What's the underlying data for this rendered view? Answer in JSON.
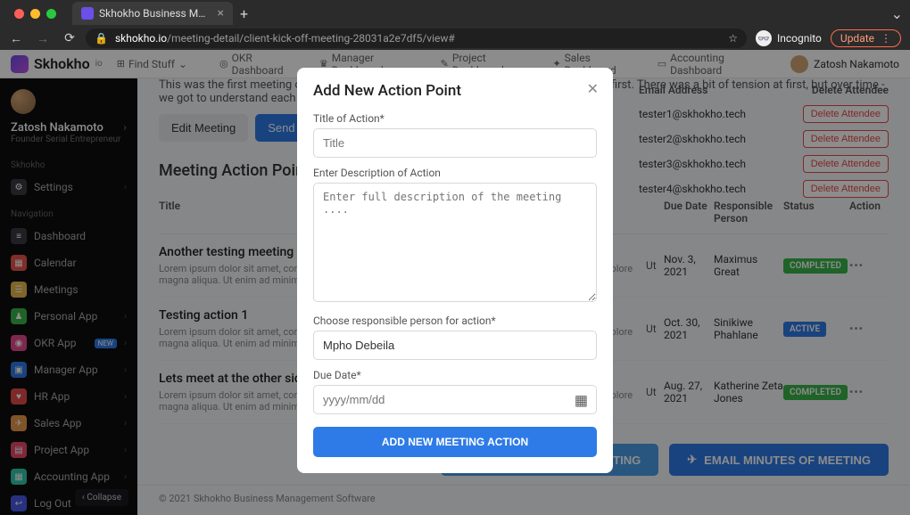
{
  "browser": {
    "tab_title": "Skhokho Business Managemen",
    "url_host": "skhokho.io",
    "url_path": "/meeting-detail/client-kick-off-meeting-28031a2e7df5/view#",
    "incognito_label": "Incognito",
    "update_label": "Update"
  },
  "app": {
    "brand": "Skhokho",
    "brand_sub": "io",
    "find_label": "Find Stuff",
    "topnav": [
      {
        "icon": "◎",
        "label": "OKR Dashboard"
      },
      {
        "icon": "♛",
        "label": "Manager Dashboard"
      },
      {
        "icon": "✎",
        "label": "Project Dashboard"
      },
      {
        "icon": "✦",
        "label": "Sales Dashboard"
      },
      {
        "icon": "▭",
        "label": "Accounting Dashboard"
      }
    ],
    "user_name": "Zatosh Nakamoto"
  },
  "sidebar": {
    "user_name": "Zatosh Nakamoto",
    "user_role": "Founder Serial Entrepreneur",
    "section1": "Skhokho",
    "settings_label": "Settings",
    "section2": "Navigation",
    "items": [
      {
        "label": "Dashboard",
        "color": "#3a3a42",
        "icon": "≡"
      },
      {
        "label": "Calendar",
        "color": "#e8554a",
        "icon": "▦"
      },
      {
        "label": "Meetings",
        "color": "#e8b84a",
        "icon": "☰"
      },
      {
        "label": "Personal App",
        "color": "#3ab54a",
        "icon": "♟"
      },
      {
        "label": "OKR App",
        "color": "#e84a8e",
        "icon": "◉",
        "badge": "NEW"
      },
      {
        "label": "Manager App",
        "color": "#2e7be8",
        "icon": "▣"
      },
      {
        "label": "HR App",
        "color": "#e84a4a",
        "icon": "♥"
      },
      {
        "label": "Sales App",
        "color": "#e89a4a",
        "icon": "✈"
      },
      {
        "label": "Project App",
        "color": "#e84a6a",
        "icon": "▤"
      },
      {
        "label": "Accounting App",
        "color": "#2ec8a8",
        "icon": "▦"
      },
      {
        "label": "Log Out",
        "color": "#4a5ae8",
        "icon": "↩"
      }
    ],
    "collapse_label": "Collapse"
  },
  "page": {
    "desc": "This was the first meeting of many, we discussed the things that the client wanted done first. There was a bit of tension at first, but over time - we got to understand each other.",
    "edit_btn": "Edit Meeting",
    "send_btn": "Send Meeting Invite",
    "section_title": "Meeting Action Points",
    "headers": {
      "title": "Title",
      "due": "Due Date",
      "resp": "Responsible Person",
      "status": "Status",
      "action": "Action"
    },
    "rows": [
      {
        "title": "Another testing meeting action point",
        "desc": "Lorem ipsum dolor sit amet, consectetur adipiscing elit, sed do eiusmod tempor incididunt ut labore et dolore magna aliqua. Ut enim ad minim veniam, quis nostrud exercitation",
        "ut": "Ut",
        "due": "Nov. 3, 2021",
        "resp": "Maximus Great",
        "status": "COMPLETED",
        "status_class": "status-completed"
      },
      {
        "title": "Testing action 1",
        "desc": "Lorem ipsum dolor sit amet, consectetur adipiscing elit, sed do eiusmod tempor incididunt ut labore et dolore magna aliqua. Ut enim ad minim veniam, quis nostrud exercitation",
        "ut": "Ut",
        "due": "Oct. 30, 2021",
        "resp": "Sinikiwe Phahlane",
        "status": "ACTIVE",
        "status_class": "status-active"
      },
      {
        "title": "Lets meet at the other side of town for a beer?",
        "desc": "Lorem ipsum dolor sit amet, consectetur adipiscing elit, sed do eiusmod tempor incididunt ut labore et dolore magna aliqua. Ut enim ad minim veniam, quis nostrud exercitation",
        "ut": "Ut",
        "due": "Aug. 27, 2021",
        "resp": "Katherine Zeta Jones",
        "status": "COMPLETED",
        "status_class": "status-completed"
      }
    ],
    "attendee_headers": {
      "email": "Email Address",
      "delete": "Delete Attendee"
    },
    "attendees": [
      {
        "email": "tester1@skhokho.tech"
      },
      {
        "email": "tester2@skhokho.tech"
      },
      {
        "email": "tester3@skhokho.tech"
      },
      {
        "email": "tester4@skhokho.tech"
      }
    ],
    "delete_label": "Delete Attendee",
    "view_minutes": "VIEW MINUTES OF MEETING",
    "email_minutes": "EMAIL MINUTES OF MEETING",
    "footer": "© 2021 Skhokho Business Management Software"
  },
  "modal": {
    "title": "Add New Action Point",
    "label_title": "Title of Action*",
    "placeholder_title": "Title",
    "label_desc": "Enter Description of Action",
    "placeholder_desc": "Enter full description of the meeting ....",
    "label_person": "Choose responsible person for action*",
    "person_value": "Mpho Debeila",
    "label_due": "Due Date*",
    "placeholder_due": "yyyy/mm/dd",
    "submit": "ADD NEW MEETING ACTION"
  }
}
